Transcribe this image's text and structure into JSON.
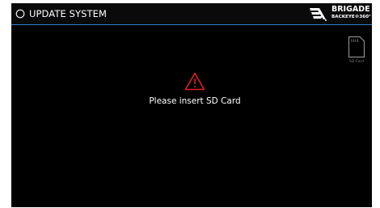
{
  "header": {
    "title": "UPDATE SYSTEM",
    "icon": "refresh-circle-icon",
    "accent_color": "#2f7fd0"
  },
  "brand": {
    "name": "BRIGADE",
    "sub": "BACKEYE®360°"
  },
  "sd_status": {
    "icon": "sd-card-icon",
    "label": "SD Card"
  },
  "alert": {
    "icon": "warning-triangle-icon",
    "icon_color": "#e02020",
    "message": "Please insert SD Card"
  }
}
